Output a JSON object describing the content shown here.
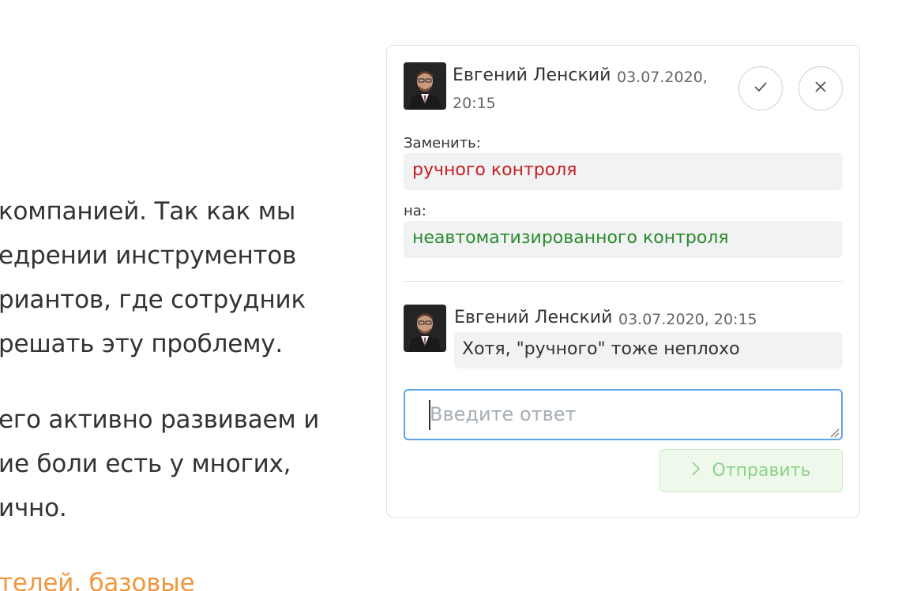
{
  "document": {
    "lines": [
      "компанией. Так как мы",
      "едрении инструментов",
      "риантов, где сотрудник",
      " решать эту проблему.",
      "его активно развиваем и",
      "ие боли есть у многих,",
      "ично.",
      "телей, базовые"
    ]
  },
  "comment": {
    "author": "Евгений Ленский",
    "timestamp_part1": "03.07.2020,",
    "timestamp_part2": "20:15",
    "replace_label": "Заменить:",
    "old_text": "ручного контроля",
    "with_label": "на:",
    "new_text": "неавтоматизированного контроля",
    "accept_icon": "check-icon",
    "reject_icon": "close-icon"
  },
  "reply": {
    "author": "Евгений Ленский",
    "timestamp": "03.07.2020, 20:15",
    "text": "Хотя, \"ручного\" тоже неплохо"
  },
  "reply_input": {
    "placeholder": "Введите ответ",
    "value": ""
  },
  "send_button": {
    "label": "Отправить",
    "icon": "chevron-right-icon"
  },
  "colors": {
    "removed": "#c42020",
    "added": "#2a8a2a",
    "link_orange": "#f0963c",
    "input_focus": "#5ea6ea",
    "send_bg": "#eef9ec"
  }
}
